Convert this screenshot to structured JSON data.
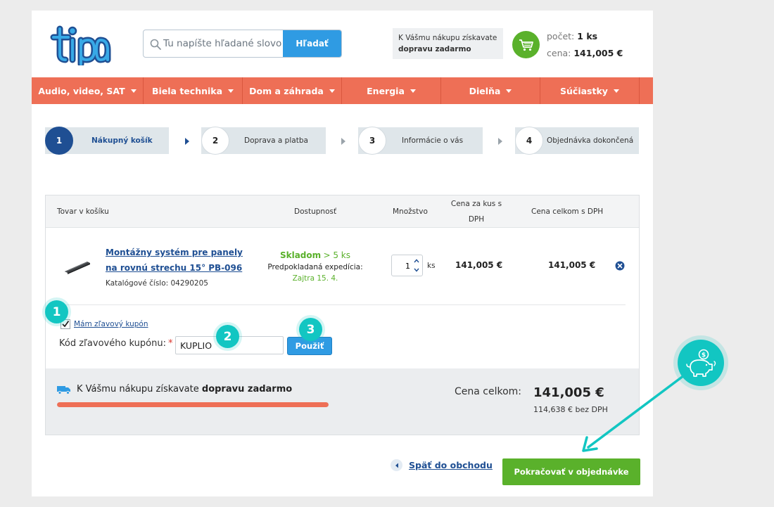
{
  "header": {
    "search_placeholder": "Tu napíšte hľadané slovo či kód",
    "search_button": "Hľadať",
    "promo_line1": "K Vášmu nákupu získavate",
    "promo_line2": "dopravu zadarmo",
    "cart_count_label": "počet:",
    "cart_count_value": "1 ks",
    "cart_price_label": "cena:",
    "cart_price_value": "141,005 €"
  },
  "nav": {
    "items": [
      {
        "label": "Audio, video, SAT"
      },
      {
        "label": "Biela technika"
      },
      {
        "label": "Dom a záhrada"
      },
      {
        "label": "Energia"
      },
      {
        "label": "Dielňa"
      },
      {
        "label": "Súčiastky"
      }
    ]
  },
  "steps": [
    {
      "num": "1",
      "label": "Nákupný košík",
      "active": true
    },
    {
      "num": "2",
      "label": "Doprava a platba"
    },
    {
      "num": "3",
      "label": "Informácie o vás"
    },
    {
      "num": "4",
      "label": "Objednávka dokončená"
    }
  ],
  "table": {
    "col_product": "Tovar v košíku",
    "col_availability": "Dostupnosť",
    "col_quantity": "Množstvo",
    "col_unit_price": "Cena za kus s DPH",
    "col_total_price": "Cena celkom s DPH"
  },
  "item": {
    "name": "Montážny systém pre panely na rovnú strechu 15° PB-096",
    "catalog": "Katalógové číslo: 04290205",
    "stock": "Skladom",
    "stock_count": "> 5 ks",
    "expedition_label": "Predpokladaná expedícia:",
    "expedition_date": "Zajtra 15. 4.",
    "quantity": "1",
    "unit": "ks",
    "unit_price": "141,005 €",
    "total_price": "141,005 €"
  },
  "coupon": {
    "toggle_label": "Mám zľavový kupón",
    "field_label": "Kód zľavového kupónu:",
    "required_mark": "*",
    "value": "KUPLIO",
    "apply_button": "Použiť"
  },
  "summary": {
    "free_shipping_prefix": "K Vášmu nákupu získavate",
    "free_shipping_bold": "dopravu zadarmo",
    "free_shipping_progress": 1.0,
    "total_label": "Cena celkom:",
    "total_value": "141,005 €",
    "total_net": "114,638 € bez DPH"
  },
  "actions": {
    "back_label": "Späť do obchodu",
    "continue_label": "Pokračovať v objednávke"
  },
  "annotations": {
    "badge1": "1",
    "badge2": "2",
    "badge3": "3"
  },
  "colors": {
    "nav_bg": "#ee6f56",
    "primary_blue": "#1f4f93",
    "button_blue": "#2f9be3",
    "green": "#5ab12b",
    "teal_marker": "#12c6c2"
  }
}
